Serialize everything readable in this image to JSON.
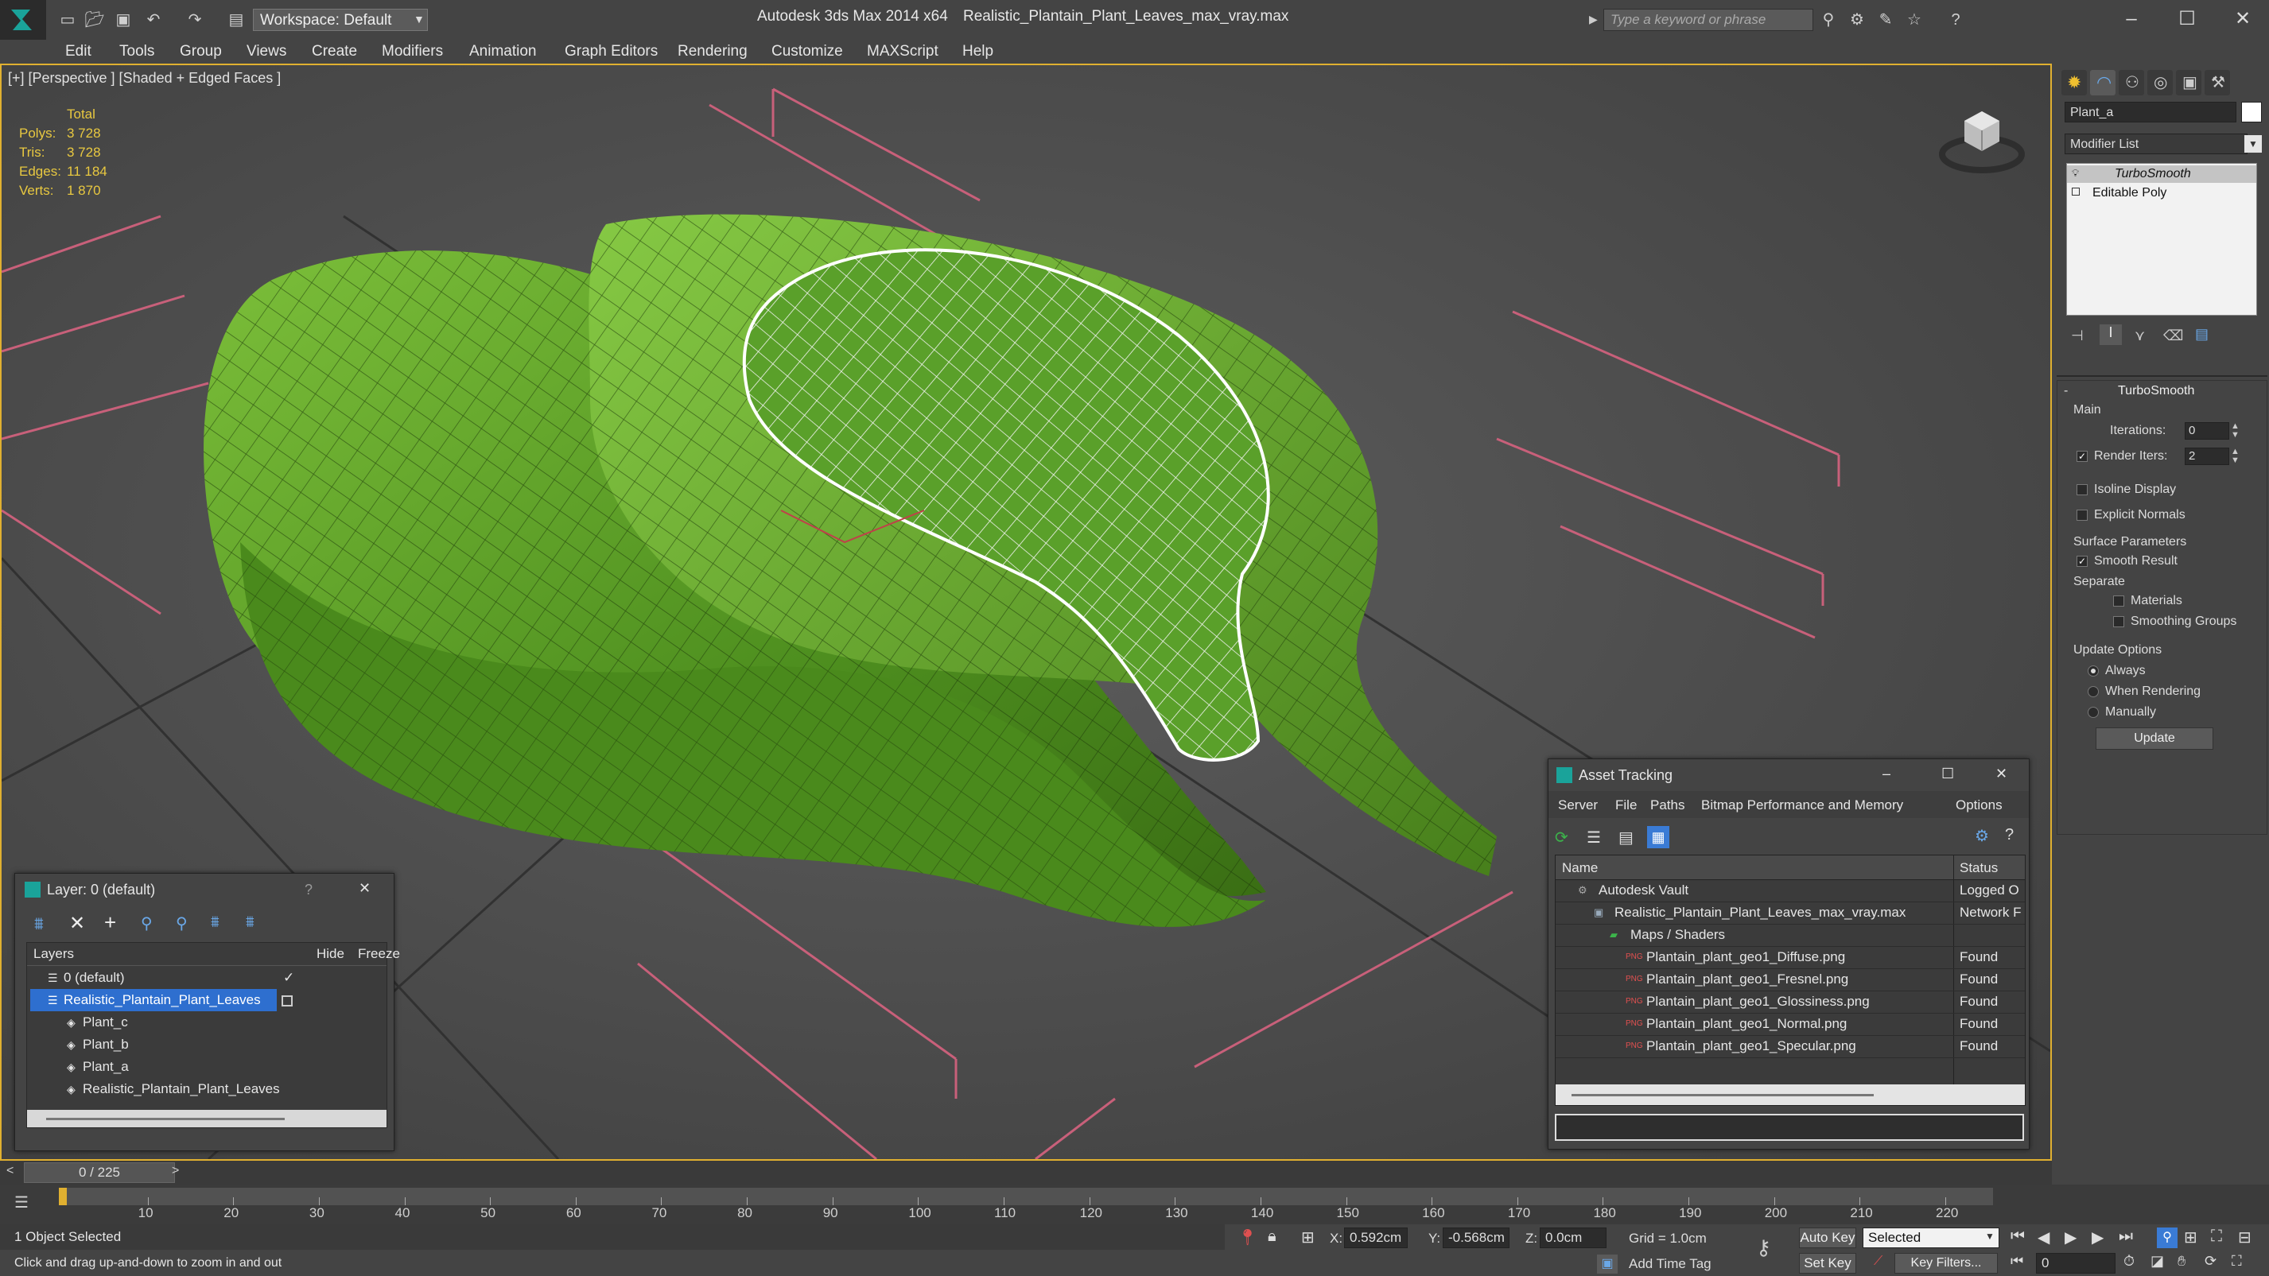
{
  "titlebar": {
    "app_title": "Autodesk 3ds Max  2014 x64",
    "file_title": "Realistic_Plantain_Plant_Leaves_max_vray.max",
    "workspace": "Workspace: Default",
    "search_placeholder": "Type a keyword or phrase"
  },
  "menu": [
    "Edit",
    "Tools",
    "Group",
    "Views",
    "Create",
    "Modifiers",
    "Animation",
    "Graph Editors",
    "Rendering",
    "Customize",
    "MAXScript",
    "Help"
  ],
  "viewport": {
    "label": "[+] [Perspective ] [Shaded + Edged Faces ]",
    "stats": {
      "header": "Total",
      "rows": [
        {
          "label": "Polys:",
          "value": "3 728"
        },
        {
          "label": "Tris:",
          "value": "3 728"
        },
        {
          "label": "Edges:",
          "value": "11 184"
        },
        {
          "label": "Verts:",
          "value": "1 870"
        }
      ]
    }
  },
  "command_panel": {
    "object_name": "Plant_a",
    "modifier_list": "Modifier List",
    "stack": [
      "TurboSmooth",
      "Editable Poly"
    ],
    "rollout": {
      "title": "TurboSmooth",
      "main": "Main",
      "iterations_label": "Iterations:",
      "iterations_value": "0",
      "render_iters_label": "Render Iters:",
      "render_iters_value": "2",
      "isoline": "Isoline Display",
      "explicit_normals": "Explicit Normals",
      "surface_params": "Surface Parameters",
      "smooth_result": "Smooth Result",
      "separate": "Separate",
      "materials": "Materials",
      "smoothing_groups": "Smoothing Groups",
      "update_options": "Update Options",
      "always": "Always",
      "when_rendering": "When Rendering",
      "manually": "Manually",
      "update_button": "Update"
    }
  },
  "layer_dialog": {
    "title": "Layer: 0 (default)",
    "help": "?",
    "col_layers": "Layers",
    "col_hide": "Hide",
    "col_freeze": "Freeze",
    "rows": [
      {
        "name": "0 (default)",
        "indent": 0
      },
      {
        "name": "Realistic_Plantain_Plant_Leaves",
        "indent": 0,
        "selected": true
      },
      {
        "name": "Plant_c",
        "indent": 1
      },
      {
        "name": "Plant_b",
        "indent": 1
      },
      {
        "name": "Plant_a",
        "indent": 1
      },
      {
        "name": "Realistic_Plantain_Plant_Leaves",
        "indent": 1
      }
    ]
  },
  "asset_dialog": {
    "title": "Asset Tracking",
    "menu": [
      "Server",
      "File",
      "Paths",
      "Bitmap Performance and Memory",
      "Options"
    ],
    "col_name": "Name",
    "col_status": "Status",
    "rows": [
      {
        "name": "Autodesk Vault",
        "status": "Logged O",
        "indent": 1
      },
      {
        "name": "Realistic_Plantain_Plant_Leaves_max_vray.max",
        "status": "Network F",
        "indent": 2
      },
      {
        "name": "Maps / Shaders",
        "status": "",
        "indent": 3
      },
      {
        "name": "Plantain_plant_geo1_Diffuse.png",
        "status": "Found",
        "indent": 4
      },
      {
        "name": "Plantain_plant_geo1_Fresnel.png",
        "status": "Found",
        "indent": 4
      },
      {
        "name": "Plantain_plant_geo1_Glossiness.png",
        "status": "Found",
        "indent": 4
      },
      {
        "name": "Plantain_plant_geo1_Normal.png",
        "status": "Found",
        "indent": 4
      },
      {
        "name": "Plantain_plant_geo1_Specular.png",
        "status": "Found",
        "indent": 4
      }
    ]
  },
  "timeline": {
    "frame": "0 / 225",
    "ticks": [
      "10",
      "20",
      "30",
      "40",
      "50",
      "60",
      "70",
      "80",
      "90",
      "100",
      "110",
      "120",
      "130",
      "140",
      "150",
      "160",
      "170",
      "180",
      "190",
      "200",
      "210",
      "220"
    ]
  },
  "status": {
    "selected": "1 Object Selected",
    "hint": "Click and drag up-and-down to zoom in and out",
    "x_label": "X:",
    "x_value": "0.592cm",
    "y_label": "Y:",
    "y_value": "-0.568cm",
    "z_label": "Z:",
    "z_value": "0.0cm",
    "grid": "Grid = 1.0cm",
    "auto_key": "Auto Key",
    "set_key": "Set Key",
    "selected_dropdown": "Selected",
    "key_filters": "Key Filters...",
    "add_time_tag": "Add Time Tag",
    "frame_value": "0"
  },
  "colors": {
    "accent": "#3a7bd5",
    "viewport_border": "#e0b030",
    "stat_text": "#e8c840",
    "leaf": "#5a9a28"
  }
}
